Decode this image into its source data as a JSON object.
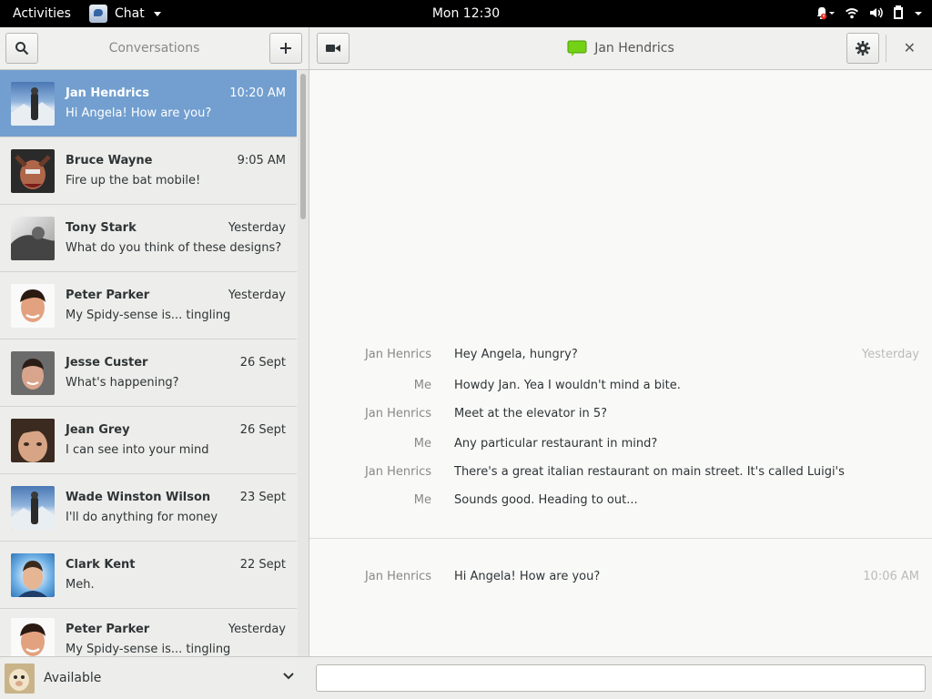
{
  "topbar": {
    "activities": "Activities",
    "app_name": "Chat",
    "clock": "Mon 12:30",
    "icons": [
      "notification-warning-icon",
      "wifi-icon",
      "volume-icon",
      "battery-icon",
      "system-menu-icon"
    ]
  },
  "sidebar": {
    "title": "Conversations",
    "search_icon": "search-icon",
    "add_icon": "plus-icon",
    "conversations": [
      {
        "name": "Jan Hendrics",
        "time": "10:20 AM",
        "message": "Hi Angela! How are you?",
        "selected": true
      },
      {
        "name": "Bruce Wayne",
        "time": "9:05 AM",
        "message": "Fire up the bat mobile!"
      },
      {
        "name": "Tony Stark",
        "time": "Yesterday",
        "message": "What do you think of these designs?"
      },
      {
        "name": "Peter Parker",
        "time": "Yesterday",
        "message": "My Spidy-sense is... tingling"
      },
      {
        "name": "Jesse Custer",
        "time": "26 Sept",
        "message": "What's happening?"
      },
      {
        "name": "Jean Grey",
        "time": "26 Sept",
        "message": "I can see into your mind"
      },
      {
        "name": "Wade Winston Wilson",
        "time": "23 Sept",
        "message": "I'll do anything for money"
      },
      {
        "name": "Clark Kent",
        "time": "22 Sept",
        "message": "Meh."
      },
      {
        "name": "Peter Parker",
        "time": "Yesterday",
        "message": "My Spidy-sense is... tingling"
      }
    ],
    "status": "Available"
  },
  "chat": {
    "contact": "Jan Hendrics",
    "messages": [
      {
        "from": "Jan Henrics",
        "text": "Hey Angela, hungry?",
        "stamp": "Yesterday"
      },
      {
        "from": "Me",
        "text": "Howdy Jan. Yea I wouldn't mind a bite.",
        "stamp": ""
      },
      {
        "from": "Jan Henrics",
        "text": "Meet at the elevator in 5?",
        "stamp": ""
      },
      {
        "from": "Me",
        "text": "Any particular restaurant in mind?",
        "stamp": ""
      },
      {
        "from": "Jan Henrics",
        "text": "There's a great italian restaurant on main street. It's called Luigi's",
        "stamp": ""
      },
      {
        "from": "Me",
        "text": "Sounds good. Heading to out...",
        "stamp": ""
      },
      {
        "from": "Jan Henrics",
        "text": "Hi Angela! How are you?",
        "stamp": "10:06 AM"
      }
    ],
    "compose_placeholder": "",
    "compose_value": ""
  },
  "colors": {
    "selection": "#729fcf",
    "accent_green": "#73d216",
    "topbar": "#000000"
  }
}
